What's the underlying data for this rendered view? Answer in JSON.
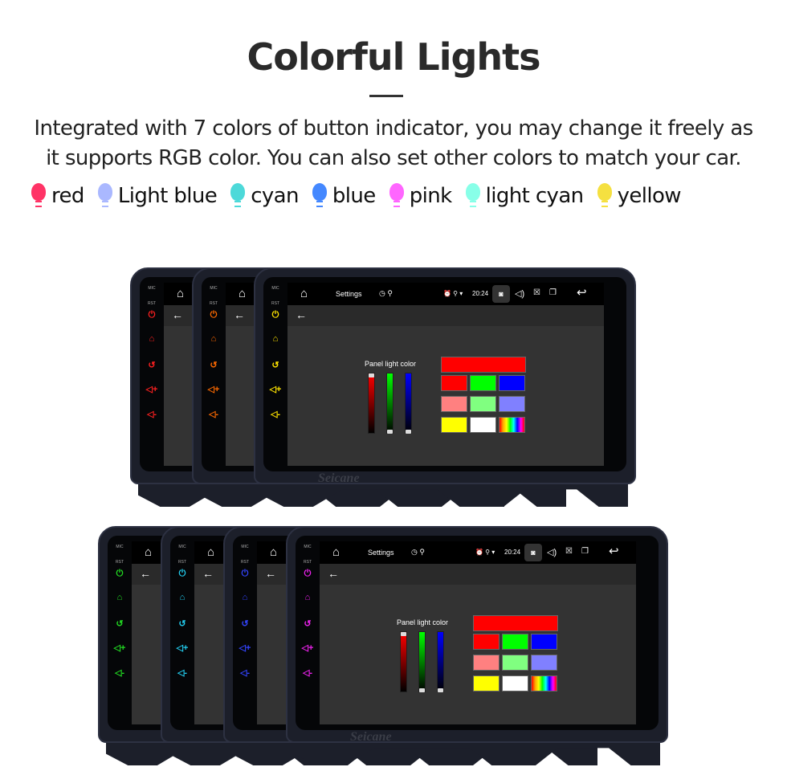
{
  "header": {
    "title": "Colorful Lights",
    "description": [
      "Integrated with 7 colors of button indicator, you may change it freely as",
      "it supports RGB color. You can also set other colors to match your car."
    ]
  },
  "legend": [
    {
      "label": "red",
      "color": "#ff3366"
    },
    {
      "label": "Light blue",
      "color": "#aab8ff"
    },
    {
      "label": "cyan",
      "color": "#4dd9d9"
    },
    {
      "label": "blue",
      "color": "#4488ff"
    },
    {
      "label": "pink",
      "color": "#ff66ff"
    },
    {
      "label": "light cyan",
      "color": "#88ffe8"
    },
    {
      "label": "yellow",
      "color": "#f5e040"
    }
  ],
  "device": {
    "mic": "MIC",
    "rst": "RST",
    "settings": "Settings",
    "time": "20:24",
    "panel_label": "Panel light color",
    "brand": "Seicane",
    "icons": [
      "home-icon",
      "timer-icon",
      "usb-icon",
      "alarm-icon",
      "location-icon",
      "wifi-icon",
      "screenshot-icon",
      "volume-icon",
      "close-app-icon",
      "recent-apps-icon",
      "return-icon",
      "back-arrow-icon",
      "power-icon",
      "vol-up-icon",
      "vol-down-icon"
    ],
    "swatches": [
      "#ff0000",
      "#00ff00",
      "#0000ff",
      "#ff8080",
      "#80ff80",
      "#8080ff",
      "#ffff00",
      "#ffffff",
      "rainbow"
    ],
    "main_swatch": "#ff0000",
    "sliders": {
      "red": 1.0,
      "green": 0.0,
      "blue": 0.0
    }
  },
  "top_row_indicator_colors": [
    "#ff2020",
    "#ff6a00",
    "#ffe400"
  ],
  "bottom_row_indicator_colors": [
    "#22dd22",
    "#22ccee",
    "#3344ff",
    "#ee22ee"
  ]
}
